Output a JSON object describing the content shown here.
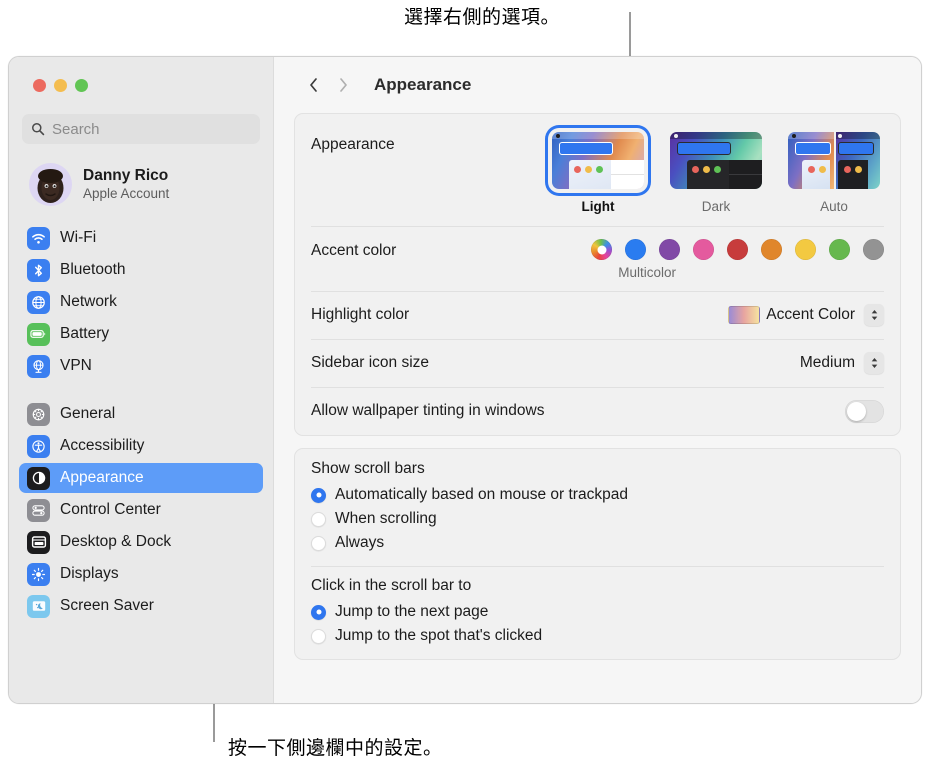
{
  "annotations": {
    "top": "選擇右側的選項。",
    "bottom": "按一下側邊欄中的設定。"
  },
  "window": {
    "traffic_lights": [
      "close",
      "minimize",
      "zoom"
    ]
  },
  "sidebar": {
    "search": {
      "placeholder": "Search",
      "icon": "search-icon"
    },
    "account": {
      "name": "Danny Rico",
      "subtitle": "Apple Account",
      "avatar": "memoji-avatar"
    },
    "groups": [
      {
        "items": [
          {
            "label": "Wi-Fi",
            "icon": "wifi-icon",
            "color": "#3b7ff0"
          },
          {
            "label": "Bluetooth",
            "icon": "bluetooth-icon",
            "color": "#3b7ff0"
          },
          {
            "label": "Network",
            "icon": "globe-icon",
            "color": "#3b7ff0"
          },
          {
            "label": "Battery",
            "icon": "battery-icon",
            "color": "#58c05a"
          },
          {
            "label": "VPN",
            "icon": "vpn-globe-icon",
            "color": "#3b7ff0"
          }
        ]
      },
      {
        "items": [
          {
            "label": "General",
            "icon": "gear-icon",
            "color": "#8e8e93",
            "selected": false
          },
          {
            "label": "Accessibility",
            "icon": "accessibility-icon",
            "color": "#3b7ff0",
            "selected": false
          },
          {
            "label": "Appearance",
            "icon": "appearance-icon",
            "color": "#1c1c1e",
            "selected": true
          },
          {
            "label": "Control Center",
            "icon": "control-center-icon",
            "color": "#8e8e93",
            "selected": false
          },
          {
            "label": "Desktop & Dock",
            "icon": "desktop-dock-icon",
            "color": "#1c1c1e",
            "selected": false
          },
          {
            "label": "Displays",
            "icon": "displays-icon",
            "color": "#3b7ff0",
            "selected": false
          },
          {
            "label": "Screen Saver",
            "icon": "screen-saver-icon",
            "color": "#7cc8ee",
            "selected": false
          }
        ]
      }
    ]
  },
  "content": {
    "toolbar": {
      "back": "back-chevron",
      "forward": "forward-chevron",
      "title": "Appearance"
    },
    "appearance": {
      "label": "Appearance",
      "options": [
        {
          "name": "Light",
          "selected": true
        },
        {
          "name": "Dark",
          "selected": false
        },
        {
          "name": "Auto",
          "selected": false
        }
      ]
    },
    "accent_color": {
      "label": "Accent color",
      "caption": "Multicolor",
      "swatches": [
        {
          "name": "Multicolor",
          "color": "multicolor",
          "selected": true
        },
        {
          "name": "Blue",
          "color": "#2a7cf0"
        },
        {
          "name": "Purple",
          "color": "#8149a6"
        },
        {
          "name": "Pink",
          "color": "#e45a9e"
        },
        {
          "name": "Red",
          "color": "#c73c3c"
        },
        {
          "name": "Orange",
          "color": "#e0862b"
        },
        {
          "name": "Yellow",
          "color": "#f3c941"
        },
        {
          "name": "Green",
          "color": "#66b84e"
        },
        {
          "name": "Graphite",
          "color": "#939393"
        }
      ]
    },
    "highlight_color": {
      "label": "Highlight color",
      "value": "Accent Color"
    },
    "sidebar_icon_size": {
      "label": "Sidebar icon size",
      "value": "Medium"
    },
    "wallpaper_tinting": {
      "label": "Allow wallpaper tinting in windows",
      "enabled": false
    },
    "show_scroll_bars": {
      "title": "Show scroll bars",
      "options": [
        {
          "label": "Automatically based on mouse or trackpad",
          "selected": true
        },
        {
          "label": "When scrolling",
          "selected": false
        },
        {
          "label": "Always",
          "selected": false
        }
      ]
    },
    "click_scroll_bar": {
      "title": "Click in the scroll bar to",
      "options": [
        {
          "label": "Jump to the next page",
          "selected": true
        },
        {
          "label": "Jump to the spot that's clicked",
          "selected": false
        }
      ]
    }
  }
}
